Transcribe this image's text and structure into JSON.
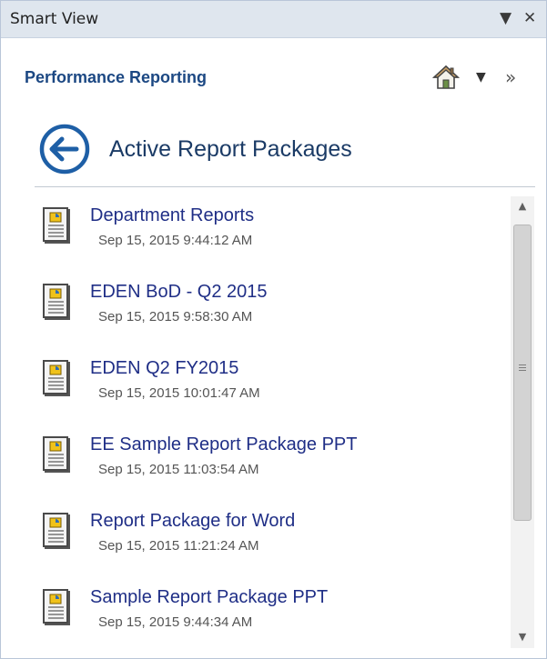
{
  "titlebar": {
    "title": "Smart View",
    "dropdown_icon": "▼",
    "close_icon": "✕"
  },
  "header": {
    "title": "Performance Reporting",
    "home_icon": "home-icon",
    "dropdown_icon": "▼",
    "expand_icon": "»"
  },
  "section": {
    "title": "Active Report Packages",
    "back_icon": "back-arrow-icon"
  },
  "items": [
    {
      "name": "Department Reports",
      "date": "Sep 15, 2015 9:44:12 AM"
    },
    {
      "name": "EDEN BoD - Q2 2015",
      "date": "Sep 15, 2015 9:58:30 AM"
    },
    {
      "name": "EDEN Q2 FY2015",
      "date": "Sep 15, 2015 10:01:47 AM"
    },
    {
      "name": "EE Sample Report Package PPT",
      "date": "Sep 15, 2015 11:03:54 AM"
    },
    {
      "name": "Report Package for Word",
      "date": "Sep 15, 2015 11:21:24 AM"
    },
    {
      "name": "Sample Report Package PPT",
      "date": "Sep 15, 2015 9:44:34 AM"
    }
  ],
  "scrollbar": {
    "up_arrow": "▲",
    "down_arrow": "▼"
  },
  "colors": {
    "title_blue": "#1c4883",
    "link_blue": "#1f2e86",
    "back_circle": "#1e5fa6"
  }
}
